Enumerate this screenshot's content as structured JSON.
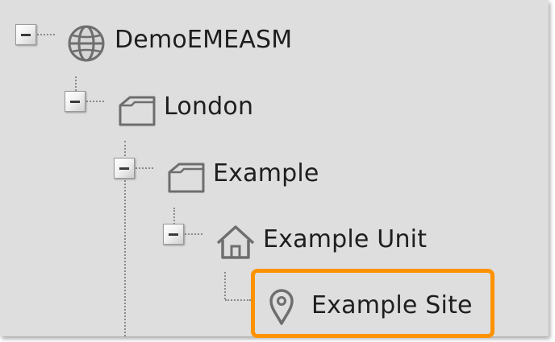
{
  "tree": {
    "accent_color": "#ff9200",
    "nodes": [
      {
        "label": "DemoEMEASM",
        "icon": "globe-icon",
        "expanded": true
      },
      {
        "label": "London",
        "icon": "folder-icon",
        "expanded": true
      },
      {
        "label": "Example",
        "icon": "folder-icon",
        "expanded": true
      },
      {
        "label": "Example Unit",
        "icon": "house-icon",
        "expanded": true
      },
      {
        "label": "Example Site",
        "icon": "map-pin-icon",
        "selected": true
      }
    ]
  }
}
